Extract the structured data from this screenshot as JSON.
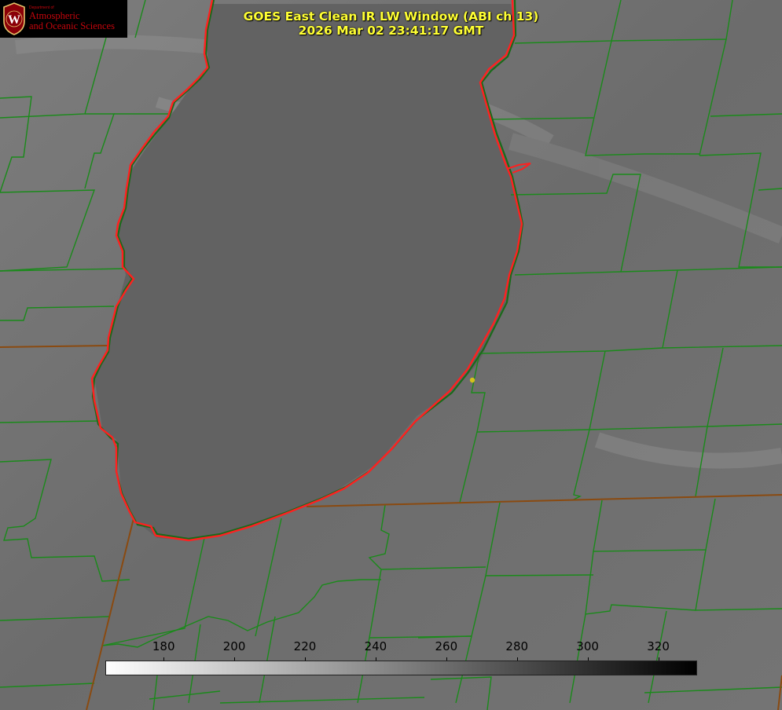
{
  "header": {
    "title_line1": "GOES East Clean IR LW Window (ABI ch 13)",
    "title_line2": "2026 Mar 02 23:41:17 GMT",
    "title_color": "#ffff33"
  },
  "logo": {
    "department_line": "Department of",
    "line1": "Atmospheric",
    "line2": "and Oceanic Sciences",
    "seal_letter": "W",
    "color": "#c5050c"
  },
  "colorbar": {
    "ticks": [
      "180",
      "200",
      "220",
      "240",
      "260",
      "280",
      "300",
      "320"
    ],
    "tick_values": [
      180,
      200,
      220,
      240,
      260,
      280,
      300,
      320
    ],
    "range": [
      163.5,
      331
    ],
    "gradient_start_color": "#ffffff",
    "gradient_end_color": "#000000"
  },
  "map": {
    "background_color": "#6f6f6f",
    "county_line_color": "#1a8a1a",
    "state_line_color": "#8a4a10",
    "coastline_color": "#ff2020",
    "marker_color": "#d4c21a"
  }
}
